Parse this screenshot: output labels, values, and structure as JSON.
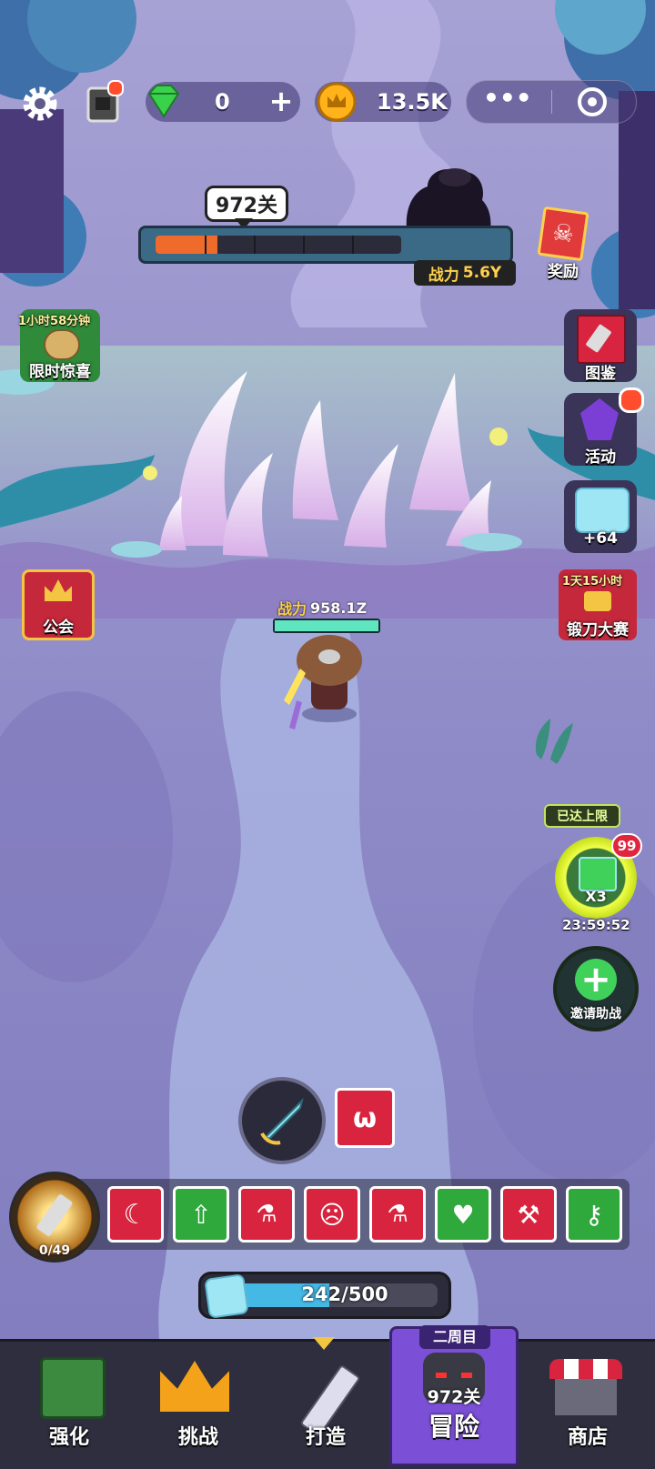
{
  "top_bar": {
    "gems": "0",
    "gold": "13.5K"
  },
  "stage": {
    "level_label": "972关",
    "boss_power_label": "战力",
    "boss_power_value": "5.6Y",
    "progress": 0.25
  },
  "right_buttons": {
    "reward": "奖励",
    "codex": "图鉴",
    "activity": "活动",
    "ice_count": "+64",
    "forge_timer": "1天15小时",
    "forge_contest": "锻刀大赛",
    "limit_reached": "已达上限",
    "boost_badge": "99",
    "boost_multiplier": "X3",
    "boost_timer": "23:59:52",
    "invite": "邀请助战"
  },
  "left_buttons": {
    "timer": "1小时58分钟",
    "limited_surprise": "限时惊喜",
    "guild": "公会"
  },
  "player": {
    "power_label": "战力",
    "power_value": "958.1Z",
    "health": 1.0
  },
  "skills": {
    "count": "0/49"
  },
  "energy": {
    "value": "242/500",
    "fraction": 0.484
  },
  "tabs": {
    "enhance": "强化",
    "challenge": "挑战",
    "forge": "打造",
    "round_badge": "二周目",
    "adventure_level": "972关",
    "adventure": "冒险",
    "shop": "商店"
  },
  "colors": {
    "skill_red": "#d8243e",
    "skill_green": "#2fa83c",
    "progress_fill": "#ef6b2c",
    "tab_active": "#7b4fd6"
  }
}
